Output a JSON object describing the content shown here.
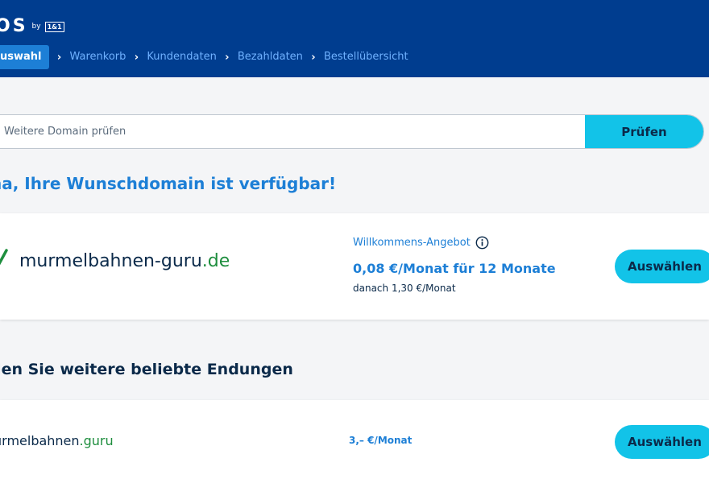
{
  "header": {
    "logo_text": "OS",
    "logo_by": "by",
    "logo_badge": "1&1",
    "breadcrumb": {
      "active": "uswahl",
      "items": [
        "Warenkorb",
        "Kundendaten",
        "Bezahldaten",
        "Bestellübersicht"
      ]
    }
  },
  "search": {
    "placeholder": "Weitere Domain prüfen",
    "button_label": "Prüfen"
  },
  "headline": "na, Ihre Wunschdomain ist verfügbar!",
  "main_result": {
    "domain_name": "murmelbahnen-guru",
    "tld": ".de",
    "offer_label": "Willkommens-Angebot",
    "offer_price": "0,08 €/Monat für 12 Monate",
    "offer_after": "danach 1,30 €/Monat",
    "select_label": "Auswählen"
  },
  "section_title": "den Sie weitere beliebte Endungen",
  "extensions": [
    {
      "domain_name": "urmelbahnen",
      "tld": ".guru",
      "price": "3,– €/Monat",
      "select_label": "Auswählen"
    }
  ],
  "colors": {
    "header_bg": "#003d8f",
    "accent": "#1d7fd6",
    "button": "#12c3e8",
    "tld_green": "#1e8e3e"
  }
}
